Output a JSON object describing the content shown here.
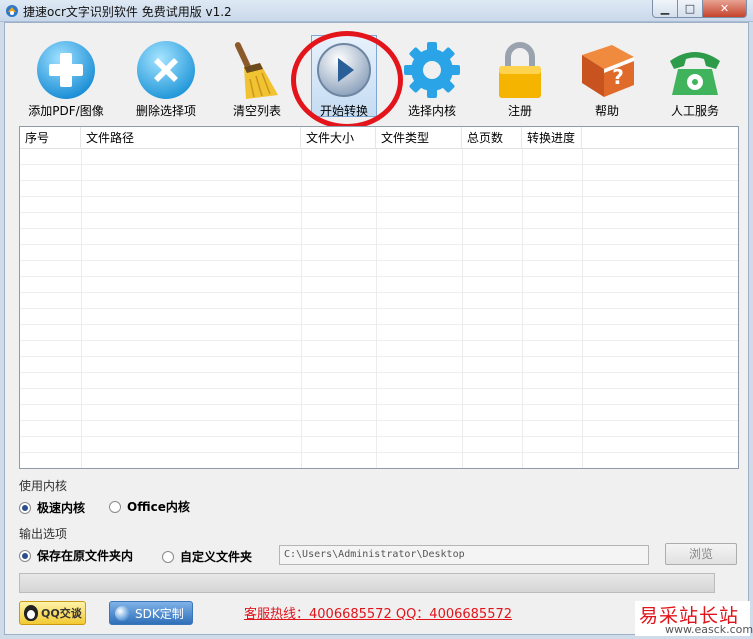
{
  "window": {
    "title": "捷速ocr文字识别软件 免费试用版 v1.2",
    "min": "▁",
    "max": "□",
    "close": "✕"
  },
  "toolbar": {
    "items": [
      {
        "label": "添加PDF/图像",
        "icon": "add-icon"
      },
      {
        "label": "删除选择项",
        "icon": "delete-icon"
      },
      {
        "label": "清空列表",
        "icon": "broom-icon"
      },
      {
        "label": "开始转换",
        "icon": "play-icon",
        "active": true
      },
      {
        "label": "选择内核",
        "icon": "gear-icon"
      },
      {
        "label": "注册",
        "icon": "lock-icon"
      },
      {
        "label": "帮助",
        "icon": "help-book-icon"
      },
      {
        "label": "人工服务",
        "icon": "telephone-icon"
      }
    ]
  },
  "table": {
    "columns": [
      "序号",
      "文件路径",
      "文件大小",
      "文件类型",
      "总页数",
      "转换进度"
    ],
    "rows": []
  },
  "engine": {
    "title": "使用内核",
    "options": [
      "极速内核",
      "Office内核"
    ],
    "selected": 0
  },
  "output": {
    "title": "输出选项",
    "options": [
      "保存在原文件夹内",
      "自定义文件夹"
    ],
    "selected": 0,
    "path": "C:\\Users\\Administrator\\Desktop",
    "browse_label": "浏览"
  },
  "progress": {
    "value": 0
  },
  "footer": {
    "qq_label": "QQ交谈",
    "sdk_label": "SDK定制",
    "hotline": "客服热线：4006685572 QQ：4006685572"
  },
  "watermark": {
    "cn": "易采站长站",
    "en": "www.easck.com"
  },
  "colors": {
    "accent": "#e0141b",
    "selection": "#c5dcf3"
  }
}
